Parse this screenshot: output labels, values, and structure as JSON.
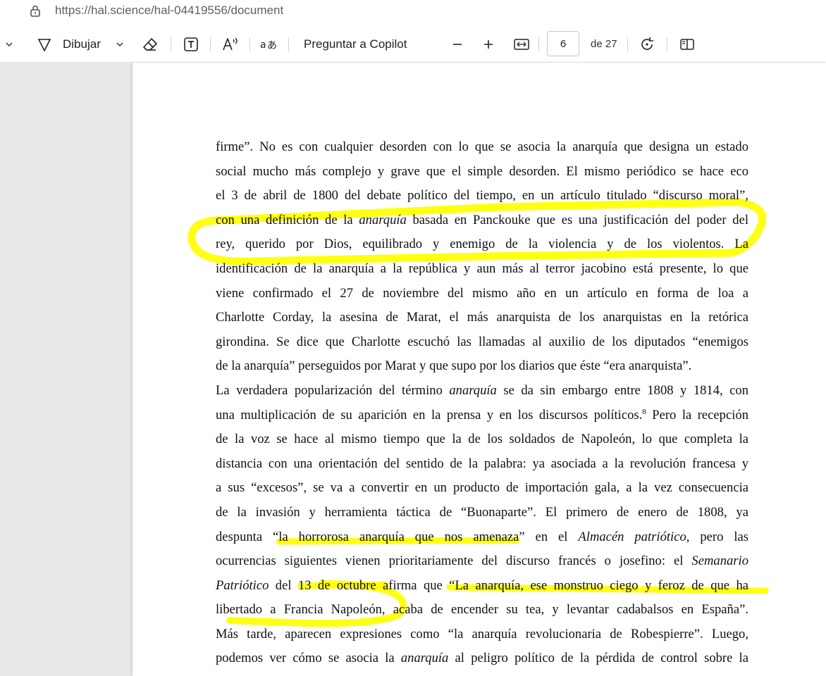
{
  "browser": {
    "url": "https://hal.science/hal-04419556/document"
  },
  "toolbar": {
    "draw_label": "Dibujar",
    "copilot_label": "Preguntar a Copilot",
    "page_current": "6",
    "page_total": "de 27",
    "icons": [
      "chevron-down-icon",
      "draw-pen-icon",
      "eraser-icon",
      "text-box-icon",
      "read-aloud-icon",
      "translate-icon",
      "zoom-out-icon",
      "zoom-in-icon",
      "fit-width-icon",
      "rotate-icon",
      "page-view-icon"
    ]
  },
  "document": {
    "highlight_color": "#ffff00",
    "lines": [
      [
        "firme”. No es con cualquier desorden con lo que se asocia la anarquía que designa un estado"
      ],
      [
        "social mucho más complejo y grave que el simple desorden. El mismo periódico se hace eco"
      ],
      [
        "el 3 de abril de 1800 del debate político del tiempo, en un artículo titulado “discurso moral”,"
      ],
      [
        "con una definición de la ",
        "anarquía",
        " basada en Panckouke que es una justificación del poder del"
      ],
      [
        "rey, querido por Dios, equilibrado y enemigo de la violencia y de los violentos. La"
      ],
      [
        "identificación de la anarquía a la república y aun más al terror jacobino está presente, lo que"
      ],
      [
        "viene confirmado el 27 de noviembre del mismo año en un artículo en forma de loa a"
      ],
      [
        "Charlotte Corday, la asesina de Marat, el más anarquista de los anarquistas en la retórica"
      ],
      [
        "girondina. Se dice que Charlotte escuchó las llamadas al auxilio de los diputados “enemigos"
      ],
      [
        "de la anarquía” perseguidos por Marat y que supo por los diarios que éste “era anarquista”."
      ],
      [
        "La verdadera popularización del término ",
        "anarquía",
        " se da sin embargo entre 1808 y 1814, con"
      ],
      [
        "una multiplicación de su aparición en la prensa y en los discursos políticos.",
        "8",
        " Pero la recepción"
      ],
      [
        "de la voz se hace al mismo tiempo que la de los soldados de Napoleón, lo que completa la"
      ],
      [
        "distancia con una orientación del sentido de la palabra: ya asociada a la revolución francesa y"
      ],
      [
        "a sus “excesos”, se va a convertir en un producto de importación gala, a la vez consecuencia"
      ],
      [
        "de la invasión y herramienta táctica de “Buonaparte”. El primero de enero de 1808, ya"
      ],
      [
        "despunta “la horrorosa anarquía que nos amenaza” en el ",
        "Almacén patriótico",
        ", pero las"
      ],
      [
        "ocurrencias siguientes vienen prioritariamente del discurso francés o josefino: el ",
        "Semanario"
      ],
      [
        "Patriótico",
        " del 13 de octubre afirma que “La anarquía, ese monstruo ciego y feroz de que ha"
      ],
      [
        "libertado a Francia Napoleón, acaba de encender su tea, y levantar cadabalsos en España”."
      ],
      [
        "Más tarde, aparecen expresiones como “la anarquía revolucionaria de Robespierre”. Luego,"
      ],
      [
        "podemos ver cómo se asocia la ",
        "anarquía",
        " al peligro político de la pérdida de control sobre la"
      ]
    ]
  }
}
